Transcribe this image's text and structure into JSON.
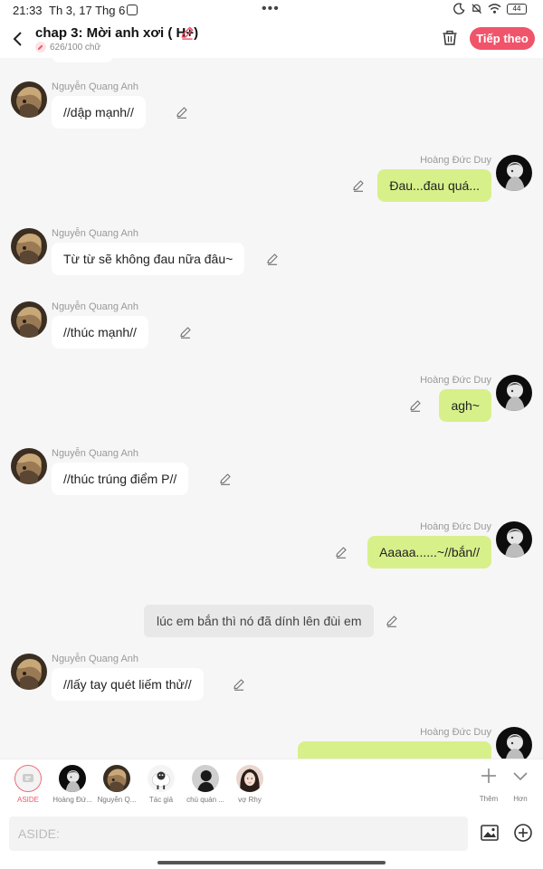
{
  "status_bar": {
    "time": "21:33",
    "date": "Th 3, 17 Thg 6",
    "battery": "44"
  },
  "header": {
    "title": "chap 3: Mời anh xơi ( H+)",
    "word_count": "626/100 chữ",
    "next_label": "Tiếp theo"
  },
  "messages": [
    {
      "side": "left",
      "sender": "Nguyễn Quang Anh",
      "text": "//dập mạnh//"
    },
    {
      "side": "right",
      "sender": "Hoàng Đức Duy",
      "text": "Đau...đau quá..."
    },
    {
      "side": "left",
      "sender": "Nguyễn Quang Anh",
      "text": "Từ từ sẽ không đau nữa đâu~"
    },
    {
      "side": "left",
      "sender": "Nguyễn Quang Anh",
      "text": "//thúc mạnh//"
    },
    {
      "side": "right",
      "sender": "Hoàng Đức Duy",
      "text": "agh~"
    },
    {
      "side": "left",
      "sender": "Nguyễn Quang Anh",
      "text": "//thúc trúng điểm P//"
    },
    {
      "side": "right",
      "sender": "Hoàng Đức Duy",
      "text": "Aaaaa......~//bắn//"
    },
    {
      "side": "aside",
      "text": "lúc em bắn thì nó đã dính lên đùi em"
    },
    {
      "side": "left",
      "sender": "Nguyễn Quang Anh",
      "text": "//lấy tay quét liếm thử//"
    },
    {
      "side": "right",
      "sender": "Hoàng Đức Duy",
      "text": ""
    }
  ],
  "characters": [
    {
      "label": "ASIDE"
    },
    {
      "label": "Hoàng Đứ..."
    },
    {
      "label": "Nguyễn Q..."
    },
    {
      "label": "Tác giả"
    },
    {
      "label": "chú quán ..."
    },
    {
      "label": "vợ Rhy"
    }
  ],
  "tools": {
    "add_label": "Thêm",
    "more_label": "Hơn"
  },
  "input": {
    "placeholder": "ASIDE:"
  },
  "colors": {
    "accent": "#f0546a",
    "right_bubble": "#d7f08a",
    "left_bubble": "#ffffff",
    "background": "#f6f6f6"
  }
}
